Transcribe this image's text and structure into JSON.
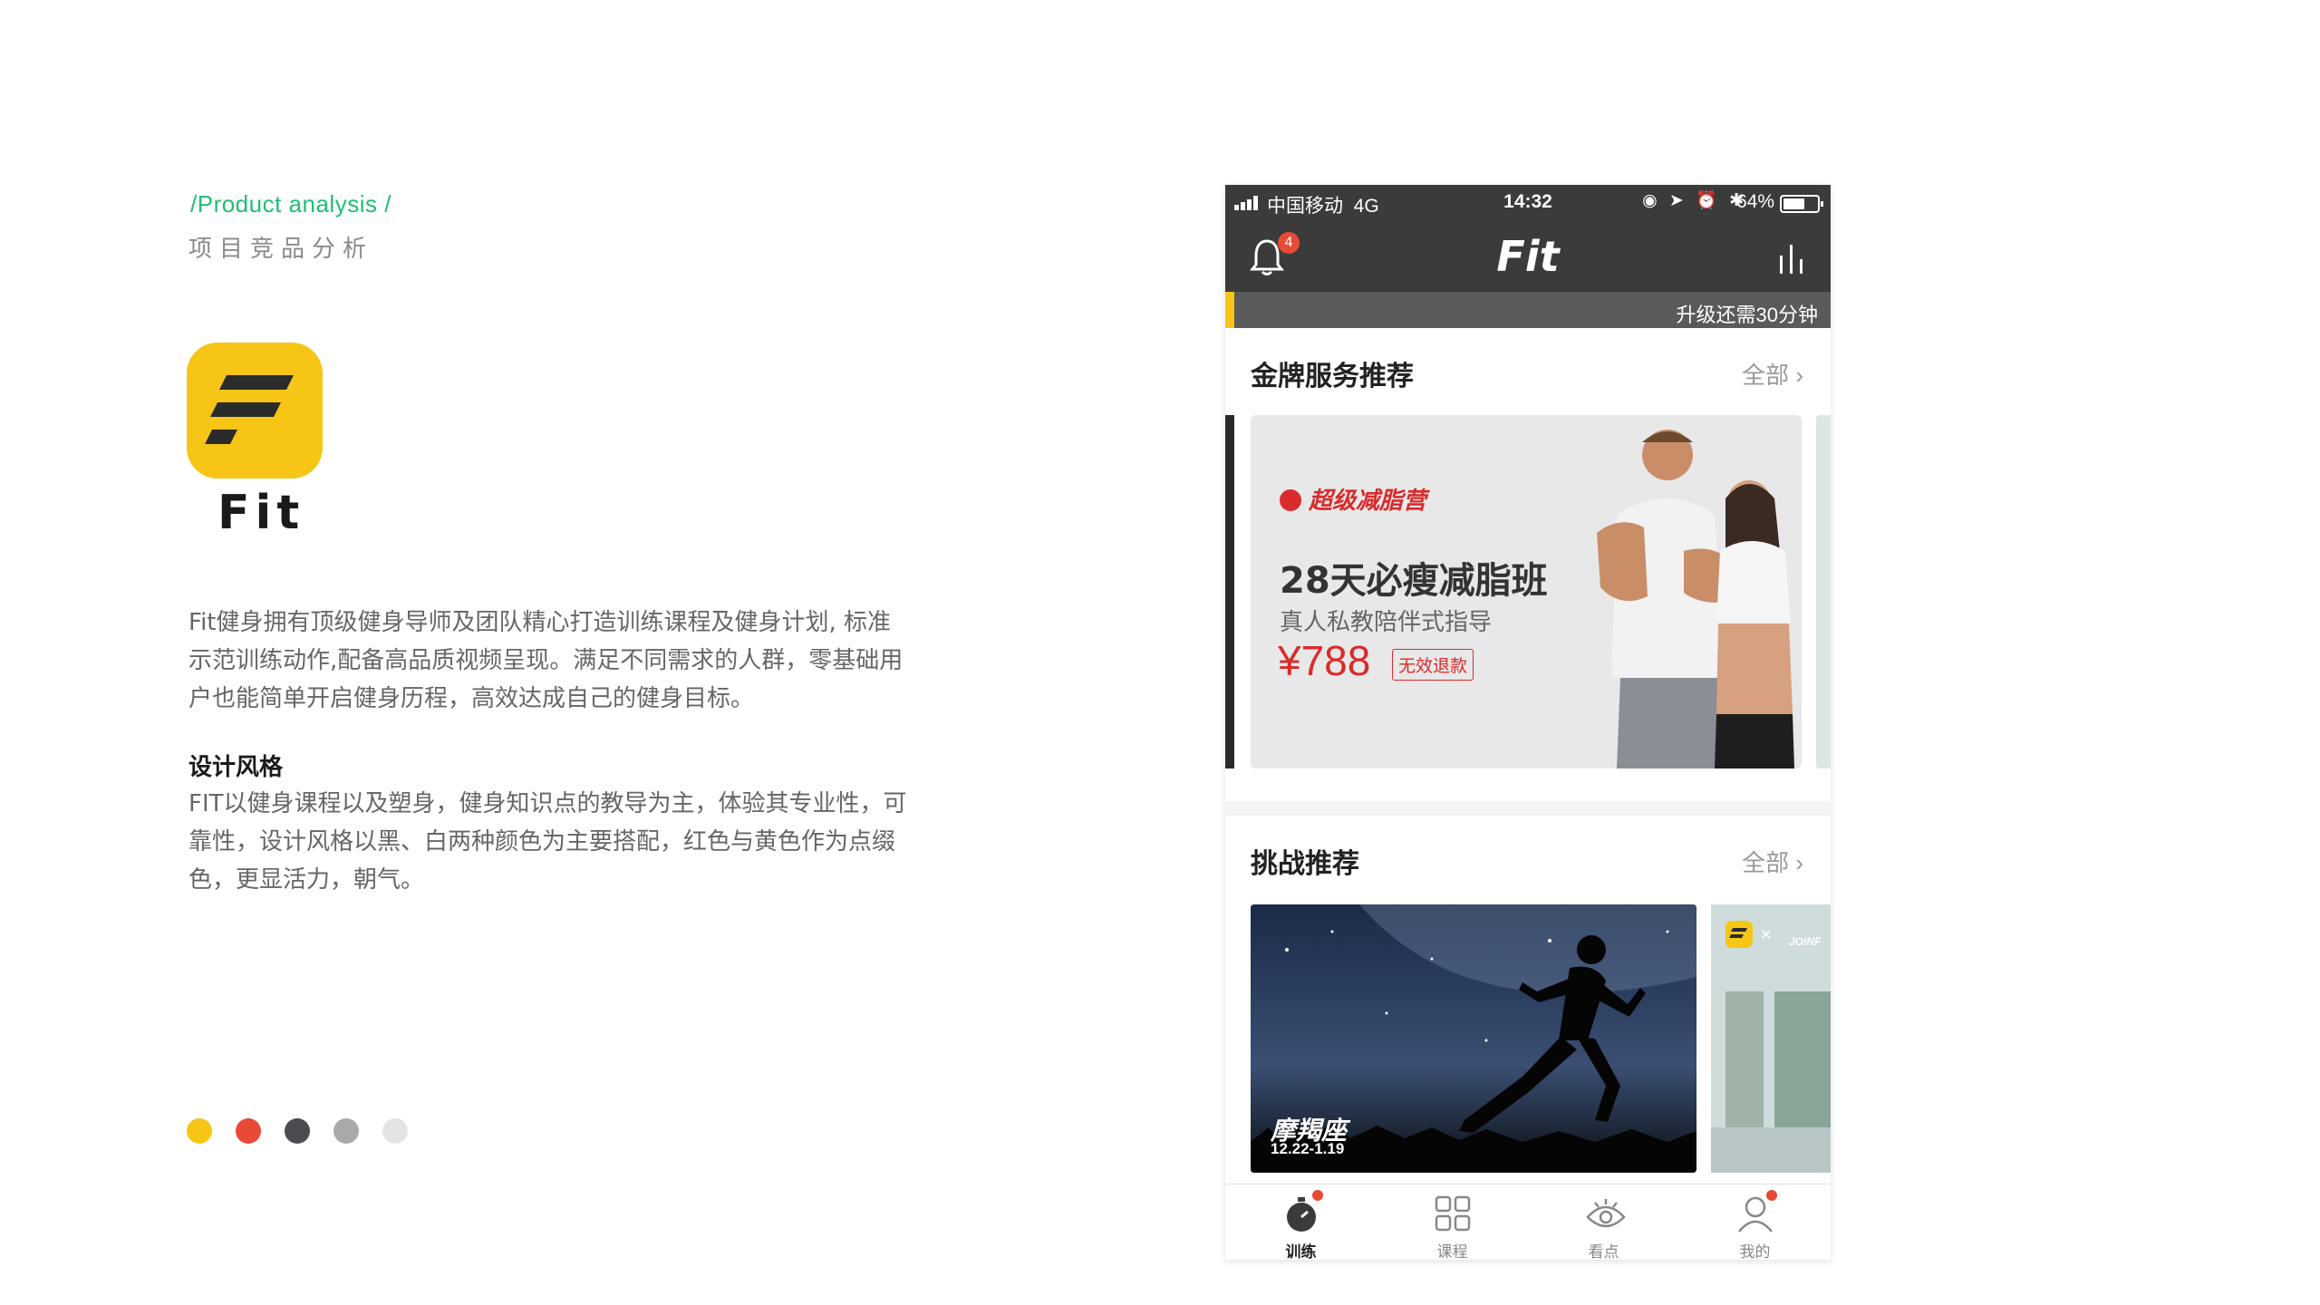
{
  "analysis": {
    "crumb": "/Product analysis /",
    "subtitle": "项目竞品分析",
    "app_name": "Fit",
    "description": "Fit健身拥有顶级健身导师及团队精心打造训练课程及健身计划, 标准示范训练动作,配备高品质视频呈现。满足不同需求的人群，零基础用户也能简单开启健身历程，高效达成自己的健身目标。",
    "style_title": "设计风格",
    "style_description": "FIT以健身课程以及塑身，健身知识点的教导为主，体验其专业性，可靠性，设计风格以黑、白两种颜色为主要搭配，红色与黄色作为点缀色，更显活力，朝气。",
    "palette": [
      "#f7c515",
      "#e94a35",
      "#4a4c52",
      "#a7a9ab",
      "#e4e4e4"
    ],
    "accent_color": "#1fbf73"
  },
  "phone": {
    "status": {
      "carrier": "中国移动",
      "network": "4G",
      "time": "14:32",
      "icons": "◉ ➤ ⏰ ✱",
      "battery": "64%",
      "battery_level": 0.64
    },
    "nav": {
      "notification_count": "4",
      "logo": "Fit"
    },
    "upgrade_text": "升级还需30分钟",
    "section_gold": {
      "title": "金牌服务推荐",
      "all_label": "全部",
      "promo": {
        "brand": "超级减脂营",
        "headline": "28天必瘦减脂班",
        "subline": "真人私教陪伴式指导",
        "price": "¥788",
        "tag": "无效退款"
      }
    },
    "section_challenge": {
      "title": "挑战推荐",
      "all_label": "全部",
      "card": {
        "name": "摩羯座",
        "date": "12.22-1.19"
      },
      "peek_text": "JOINF"
    },
    "tabs": [
      {
        "label": "训练",
        "icon": "stopwatch-icon",
        "active": true
      },
      {
        "label": "课程",
        "icon": "grid-icon",
        "active": false
      },
      {
        "label": "看点",
        "icon": "eye-icon",
        "active": false
      },
      {
        "label": "我的",
        "icon": "user-icon",
        "active": false
      }
    ],
    "colors": {
      "dark_bar": "#3b3b3b",
      "yellow": "#f7c515",
      "red": "#e94a35"
    }
  }
}
